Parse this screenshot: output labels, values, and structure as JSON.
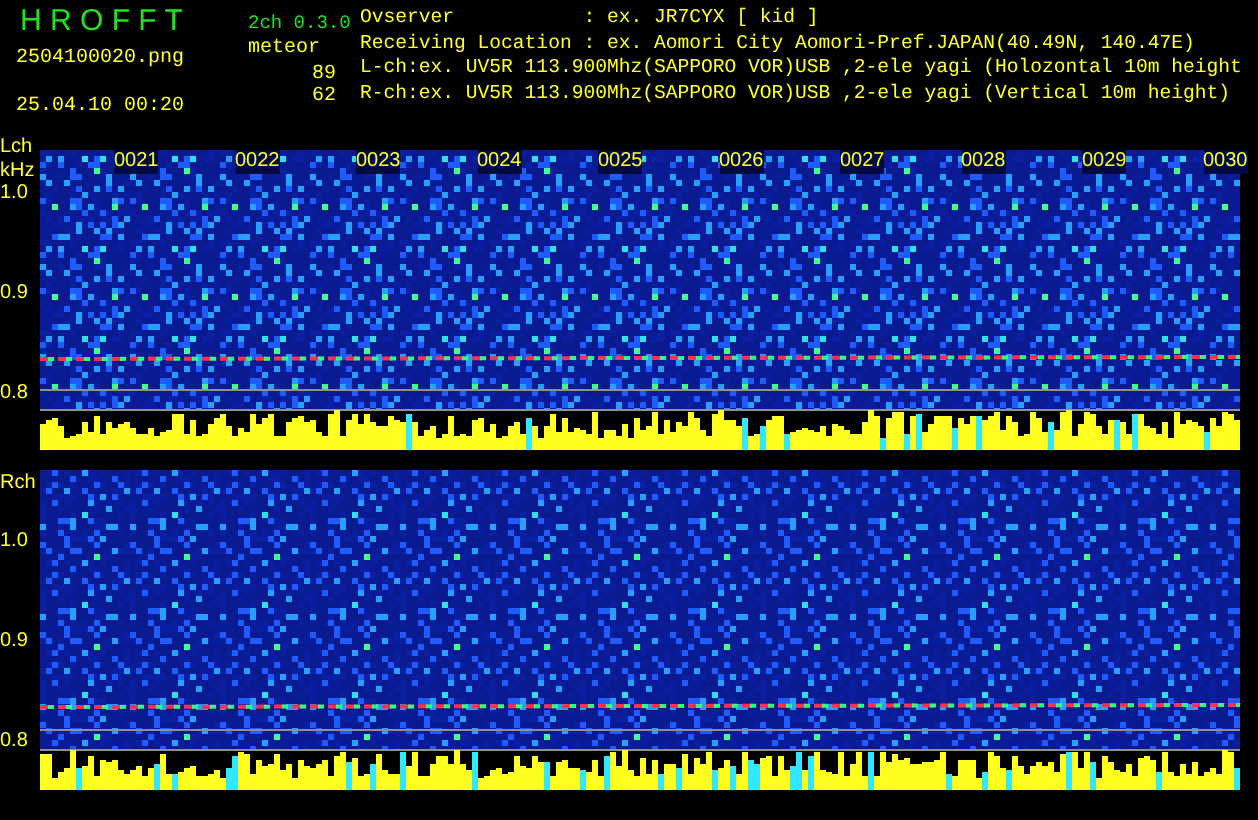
{
  "app": {
    "name": "H R O F F T",
    "version": "2ch 0.3.0"
  },
  "file": {
    "name": "2504100020.png",
    "timestamp": "25.04.10 00:20"
  },
  "meteor": {
    "label": "meteor",
    "counts": [
      "89",
      "62"
    ]
  },
  "info_lines": [
    "Ovserver           : ex. JR7CYX [ kid ]",
    "Receiving Location : ex. Aomori City Aomori-Pref.JAPAN(40.49N, 140.47E)",
    "L-ch:ex. UV5R 113.900Mhz(SAPPORO VOR)USB ,2-ele yagi (Holozontal 10m height",
    "R-ch:ex. UV5R 113.900Mhz(SAPPORO VOR)USB ,2-ele yagi (Vertical 10m height)"
  ],
  "channels": [
    {
      "name": "Lch",
      "unit": "kHz",
      "ticks": [
        "1.0",
        "0.9",
        "0.8"
      ],
      "time_labels": [
        "0021",
        "0022",
        "0023",
        "0024",
        "0025",
        "0026",
        "0027",
        "0028",
        "0029",
        "0030"
      ]
    },
    {
      "name": "Rch",
      "ticks": [
        "1.0",
        "0.9",
        "0.8"
      ]
    }
  ]
}
